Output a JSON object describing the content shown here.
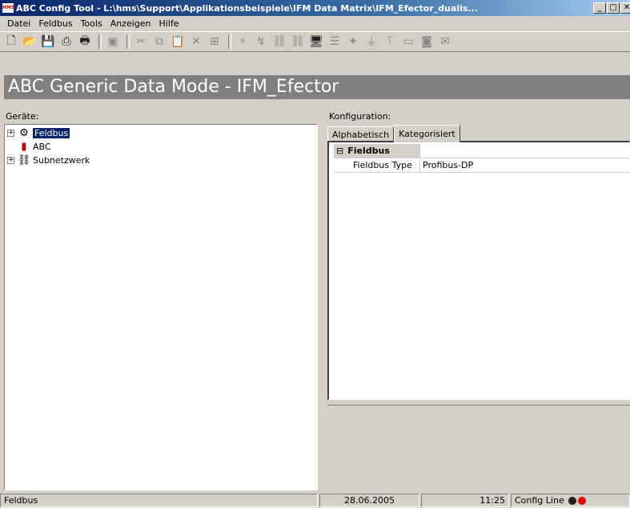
{
  "window": {
    "logo_text": "HMS",
    "title": "ABC Config Tool - L:\\hms\\Support\\Applikationsbeispiele\\IFM Data Matrix\\IFM_Efector_dualis..."
  },
  "menu": [
    "Datei",
    "Feldbus",
    "Tools",
    "Anzeigen",
    "Hilfe"
  ],
  "toolbar_icons": [
    "new-file-icon",
    "open-folder-icon",
    "save-icon",
    "print-preview-icon",
    "print-icon",
    "gallery-icon",
    "cut-icon",
    "copy-icon",
    "paste-icon",
    "delete-icon",
    "add-node-icon",
    "connect-icon",
    "disconnect-icon",
    "network-icon",
    "network-alt-icon",
    "monitor-icon",
    "properties-icon",
    "wizard-icon",
    "filter-icon",
    "scan-icon",
    "display-icon",
    "camera-icon",
    "envelope-icon"
  ],
  "header": {
    "title": "ABC Generic Data Mode - IFM_Efector"
  },
  "devices": {
    "label": "Geräte:",
    "tree": [
      {
        "label": "Feldbus",
        "selected": true,
        "expander": "+",
        "icon": "fieldbus-icon"
      },
      {
        "label": "ABC",
        "selected": false,
        "expander": "",
        "icon": "abc-module-icon"
      },
      {
        "label": "Subnetzwerk",
        "selected": false,
        "expander": "+",
        "icon": "subnetwork-icon"
      }
    ]
  },
  "config": {
    "label": "Konfiguration:",
    "tabs": [
      {
        "label": "Alphabetisch",
        "active": false
      },
      {
        "label": "Kategorisiert",
        "active": true
      }
    ],
    "category": {
      "toggle": "⊟",
      "name": "Fieldbus"
    },
    "properties": [
      {
        "name": "Fieldbus Type",
        "value": "Profibus-DP"
      }
    ]
  },
  "status": {
    "left": "Feldbus",
    "date": "28.06.2005",
    "time": "11:25",
    "line": "Config Line",
    "led_colors": [
      "#202020",
      "#e00000"
    ]
  }
}
